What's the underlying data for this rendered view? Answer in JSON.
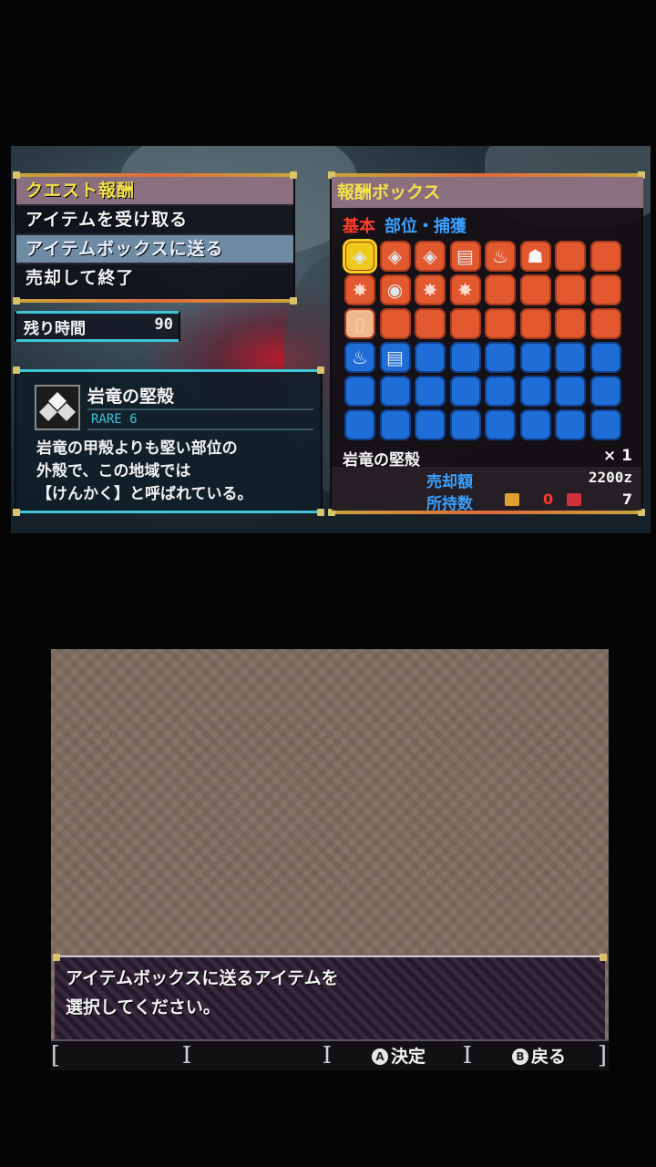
{
  "menu": {
    "title": "クエスト報酬",
    "items": [
      "アイテムを受け取る",
      "アイテムボックスに送る",
      "売却して終了"
    ],
    "selected_index": 1
  },
  "timer": {
    "label": "残り時間",
    "value": "90"
  },
  "item_detail": {
    "name": "岩竜の堅殻",
    "rarity": "RARE 6",
    "description_lines": [
      "岩竜の甲殻よりも堅い部位の",
      "外殻で、この地域では",
      "【けんかく】と呼ばれている。"
    ],
    "icon": "shell-icon"
  },
  "reward_box": {
    "title": "報酬ボックス",
    "tab_basic": "基本",
    "tab_parts": "部位・捕獲",
    "colors": {
      "basic": "#e2582f",
      "parts": "#1f6ed8",
      "title": "#f4e14a"
    },
    "slots": [
      [
        "shell",
        "shell",
        "shell",
        "ore",
        "flask",
        "bone",
        "",
        ""
      ],
      [
        "claw",
        "scale",
        "claw",
        "claw",
        "",
        "",
        "",
        ""
      ],
      [
        "ticket",
        "",
        "",
        "",
        "",
        "",
        "",
        ""
      ],
      [
        "flask",
        "ore",
        "",
        "",
        "",
        "",
        "",
        ""
      ],
      [
        "",
        "",
        "",
        "",
        "",
        "",
        "",
        ""
      ],
      [
        "",
        "",
        "",
        "",
        "",
        "",
        "",
        ""
      ]
    ],
    "cursor": {
      "row": 0,
      "col": 0
    },
    "selected_name": "岩竜の堅殻",
    "quantity_label": "× 1",
    "sell_label": "売却額",
    "sell_value": "2200z",
    "owned_label": "所持数",
    "owned_box": "0",
    "owned_total": "7"
  },
  "message": {
    "line1": "アイテムボックスに送るアイテムを",
    "line2": "選択してください。"
  },
  "footer": {
    "confirm": "決定",
    "back": "戻る",
    "confirm_button": "A",
    "back_button": "B"
  }
}
